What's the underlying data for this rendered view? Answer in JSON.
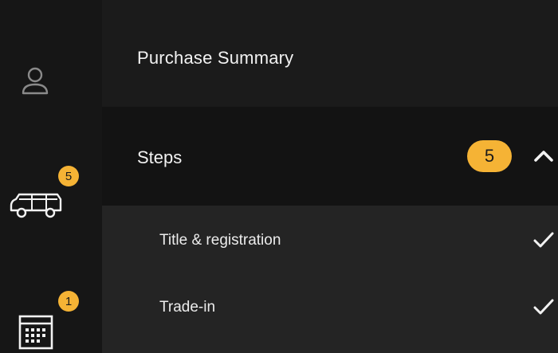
{
  "rail": {
    "vehicle_badge": "5",
    "calendar_badge": "1"
  },
  "header": {
    "title": "Purchase Summary"
  },
  "steps": {
    "label": "Steps",
    "count": "5",
    "items": [
      {
        "label": "Title & registration",
        "status_icon": "check-icon"
      },
      {
        "label": "Trade-in",
        "status_icon": "check-icon"
      }
    ]
  },
  "colors": {
    "accent": "#f5b335",
    "background": "#1b1b1b",
    "rail": "#161616",
    "steps_bar": "#131313",
    "step_list": "#242424"
  }
}
